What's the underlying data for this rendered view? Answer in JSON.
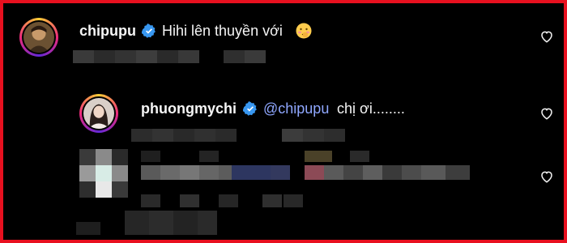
{
  "comments": [
    {
      "username": "chipupu",
      "verified": true,
      "text": "Hihi lên thuyền với",
      "emoji": "blushing-face-emoji"
    },
    {
      "username": "phuongmychi",
      "verified": true,
      "mention": "@chipupu",
      "text": "chị ơi........"
    }
  ],
  "icons": {
    "verified_badge_color": "#3897f0",
    "like": "heart-outline-icon"
  },
  "colors": {
    "background": "#000000",
    "frame_border": "#e8101f",
    "text": "#f5f5f5",
    "mention": "#8fa7ff"
  }
}
